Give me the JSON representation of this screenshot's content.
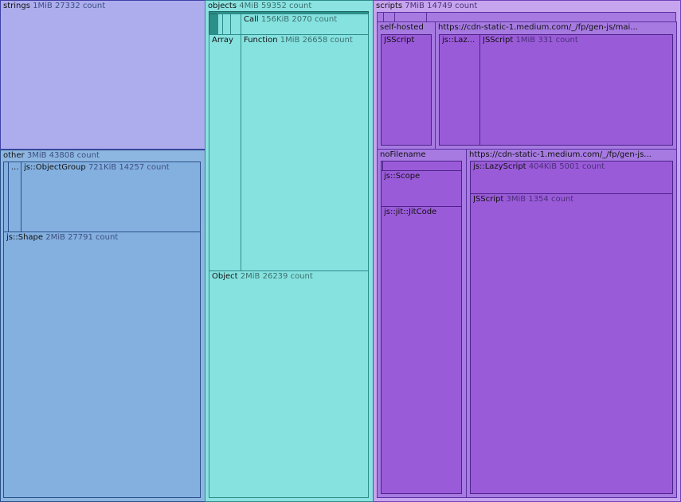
{
  "treemap": {
    "strings": {
      "name": "strings",
      "size": "1MiB",
      "count": "27332 count"
    },
    "other": {
      "name": "other",
      "size": "3MiB",
      "count": "43808 count",
      "ellipsis": "...",
      "object_group": {
        "name": "js::ObjectGroup",
        "size": "721KiB",
        "count": "14257 count"
      },
      "shape": {
        "name": "js::Shape",
        "size": "2MiB",
        "count": "27791 count"
      }
    },
    "objects": {
      "name": "objects",
      "size": "4MiB",
      "count": "59352 count",
      "call": {
        "name": "Call",
        "size": "156KiB",
        "count": "2070 count"
      },
      "array": {
        "name": "Array"
      },
      "function": {
        "name": "Function",
        "size": "1MiB",
        "count": "26658 count"
      },
      "object": {
        "name": "Object",
        "size": "2MiB",
        "count": "26239 count"
      }
    },
    "scripts": {
      "name": "scripts",
      "size": "7MiB",
      "count": "14749 count",
      "self_hosted": {
        "name": "self-hosted",
        "jsscript": "JSScript"
      },
      "main_url": {
        "name": "https://cdn-static-1.medium.com/_/fp/gen-js/mai...",
        "lazy": "js::Laz...",
        "jsscript": {
          "name": "JSScript",
          "size": "1MiB",
          "count": "331 count"
        }
      },
      "nofilename": {
        "name": "noFilename",
        "scope": "js::Scope",
        "jitcode": "js::jit::JitCode"
      },
      "gen_url": {
        "name": "https://cdn-static-1.medium.com/_/fp/gen-js...",
        "lazyscript": {
          "name": "js::LazyScript",
          "size": "404KiB",
          "count": "5001 count"
        },
        "jsscript": {
          "name": "JSScript",
          "size": "3MiB",
          "count": "1354 count"
        }
      }
    }
  }
}
